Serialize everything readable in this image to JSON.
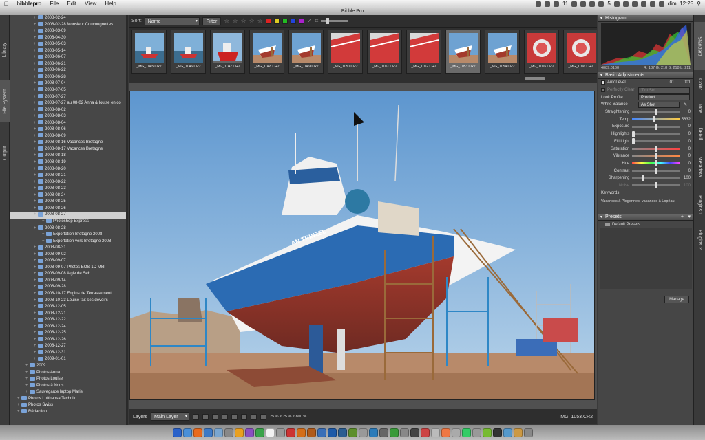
{
  "menubar": {
    "app": "bibblepro",
    "menus": [
      "File",
      "Edit",
      "View",
      "Help"
    ],
    "status_number": "11",
    "battery": "5",
    "clock": "dim. 12:25"
  },
  "window": {
    "title": "Bibble Pro"
  },
  "left_tabs": [
    "Library",
    "File System",
    "Output"
  ],
  "tree": [
    {
      "label": "2008-02-24",
      "depth": 2
    },
    {
      "label": "2008-02-28 Monsieur Coucougnettes",
      "depth": 2
    },
    {
      "label": "2008-03-09",
      "depth": 2
    },
    {
      "label": "2008-04-30",
      "depth": 2
    },
    {
      "label": "2008-05-03",
      "depth": 2
    },
    {
      "label": "2008-05-14",
      "depth": 2
    },
    {
      "label": "2008-06-07",
      "depth": 2
    },
    {
      "label": "2008-06-21",
      "depth": 2
    },
    {
      "label": "2008-06-22",
      "depth": 2
    },
    {
      "label": "2008-06-28",
      "depth": 2
    },
    {
      "label": "2008-07-04",
      "depth": 2
    },
    {
      "label": "2008-07-05",
      "depth": 2
    },
    {
      "label": "2008-07-27",
      "depth": 2
    },
    {
      "label": "2008-07-27 au 08-02 Anna & louise en co",
      "depth": 2
    },
    {
      "label": "2008-08-02",
      "depth": 2
    },
    {
      "label": "2008-08-03",
      "depth": 2
    },
    {
      "label": "2008-08-04",
      "depth": 2
    },
    {
      "label": "2008-08-06",
      "depth": 2
    },
    {
      "label": "2008-08-09",
      "depth": 2
    },
    {
      "label": "2008-08-16 Vacances Bretagne",
      "depth": 2
    },
    {
      "label": "2008-08-17 Vacances Bretagne",
      "depth": 2
    },
    {
      "label": "2008-08-18",
      "depth": 2
    },
    {
      "label": "2008-08-19",
      "depth": 2
    },
    {
      "label": "2008-08-20",
      "depth": 2
    },
    {
      "label": "2008-08-21",
      "depth": 2
    },
    {
      "label": "2008-08-22",
      "depth": 2
    },
    {
      "label": "2008-08-23",
      "depth": 2
    },
    {
      "label": "2008-08-24",
      "depth": 2
    },
    {
      "label": "2008-08-25",
      "depth": 2
    },
    {
      "label": "2008-08-26",
      "depth": 2
    },
    {
      "label": "2008-08-27",
      "depth": 2,
      "selected": true
    },
    {
      "label": "Photoshop Express",
      "depth": 3
    },
    {
      "label": "2008-08-28",
      "depth": 2
    },
    {
      "label": "Exportation Bretagne 2008",
      "depth": 3
    },
    {
      "label": "Exportation vers Bretagne 2008",
      "depth": 3
    },
    {
      "label": "2008-08-31",
      "depth": 2
    },
    {
      "label": "2008-09-02",
      "depth": 2
    },
    {
      "label": "2008-09-07",
      "depth": 2
    },
    {
      "label": "2008-09-07 Photos EOS-1D MkII",
      "depth": 2
    },
    {
      "label": "2008-09-08 Aigle de Seb",
      "depth": 2
    },
    {
      "label": "2008-09-14",
      "depth": 2
    },
    {
      "label": "2008-09-28",
      "depth": 2
    },
    {
      "label": "2008-10-17 Engins de Terrassement",
      "depth": 2
    },
    {
      "label": "2008-10-23 Louise fait ses devoirs",
      "depth": 2
    },
    {
      "label": "2008-12-05",
      "depth": 2
    },
    {
      "label": "2008-12-21",
      "depth": 2
    },
    {
      "label": "2008-12-22",
      "depth": 2
    },
    {
      "label": "2008-12-24",
      "depth": 2
    },
    {
      "label": "2008-12-25",
      "depth": 2
    },
    {
      "label": "2008-12-26",
      "depth": 2
    },
    {
      "label": "2008-12-27",
      "depth": 2
    },
    {
      "label": "2008-12-31",
      "depth": 2
    },
    {
      "label": "2009-01-01",
      "depth": 2
    },
    {
      "label": "2009",
      "depth": 1
    },
    {
      "label": "Photos Anna",
      "depth": 1
    },
    {
      "label": "Photos Louise",
      "depth": 1
    },
    {
      "label": "Photos à Nous",
      "depth": 1
    },
    {
      "label": "Sauvegarde laptop Marie",
      "depth": 1
    },
    {
      "label": "Photos Lufthansa Technik",
      "depth": 0
    },
    {
      "label": "Photos Swiss",
      "depth": 0
    },
    {
      "label": "Rédaction",
      "depth": 0
    }
  ],
  "toolbar": {
    "sort_label": "Sort:",
    "sort_value": "Name",
    "filter_label": "Filter"
  },
  "thumbnails": [
    {
      "name": "_MG_1045.CR2",
      "kind": "harbor"
    },
    {
      "name": "_MG_1046.CR2",
      "kind": "harbor"
    },
    {
      "name": "_MG_1047.CR2",
      "kind": "boat-red"
    },
    {
      "name": "_MG_1048.CR2",
      "kind": "boat-yard"
    },
    {
      "name": "_MG_1049.CR2",
      "kind": "boat-yard"
    },
    {
      "name": "_MG_1050.CR2",
      "kind": "red-hull"
    },
    {
      "name": "_MG_1051.CR2",
      "kind": "red-hull"
    },
    {
      "name": "_MG_1052.CR2",
      "kind": "red-hull"
    },
    {
      "name": "_MG_1053.CR2",
      "kind": "boat-yard",
      "selected": true
    },
    {
      "name": "_MG_1054.CR2",
      "kind": "boat-yard"
    },
    {
      "name": "_MG_1055.CR2",
      "kind": "pipe"
    },
    {
      "name": "_MG_1056.CR2",
      "kind": "pipe"
    }
  ],
  "viewer": {
    "boat_name": "AN TRINZEL"
  },
  "bottombar": {
    "layers_label": "Layers",
    "layer_value": "Main Layer",
    "zoom_text": "25 % < 25 % < 800 %",
    "filename": "_MG_1053.CR2"
  },
  "histogram": {
    "title": "Histogram",
    "coords": "4089,0160",
    "rgb": "R: 187  G: 218  B: 218  L: 211"
  },
  "basic": {
    "title": "Basic Adjustments",
    "autolevel_label": "AutoLevel",
    "autolevel_v1": ".01",
    "autolevel_v2": ".001",
    "perfectly_clear_label": "Perfectly Clear",
    "perfectly_clear_value": "Tint Std",
    "look_profile_label": "Look Profile",
    "look_profile_value": "Product",
    "white_balance_label": "White Balance",
    "white_balance_value": "As Shot",
    "sliders": [
      {
        "label": "Straightening",
        "value": "0",
        "level": 0.5
      },
      {
        "label": "Temp",
        "value": "5632",
        "level": 0.45
      },
      {
        "label": "Exposure",
        "value": "0",
        "level": 0.5
      },
      {
        "label": "Highlights",
        "value": "0",
        "level": 0.0
      },
      {
        "label": "Fill Light",
        "value": "0",
        "level": 0.0
      },
      {
        "label": "Saturation",
        "value": "0",
        "level": 0.5
      },
      {
        "label": "Vibrance",
        "value": "0",
        "level": 0.5
      },
      {
        "label": "Hue",
        "value": "0",
        "level": 0.5
      },
      {
        "label": "Contrast",
        "value": "0",
        "level": 0.5
      },
      {
        "label": "Sharpening",
        "value": "100",
        "level": 0.2
      },
      {
        "label": "Noise",
        "value": "100",
        "level": 0.5
      }
    ],
    "keywords_label": "Keywords",
    "keywords_value": "Vacances à Plogonnec, vacances à Lopéau"
  },
  "presets": {
    "title": "Presets",
    "item": "Default Presets",
    "manage": "Manage"
  },
  "right_tabs": [
    "Standard",
    "Color",
    "Tone",
    "Detail",
    "Metadata",
    "Plugins 1",
    "Plugins 2"
  ],
  "colors": {
    "accent_blue": "#7aa3d8",
    "selection": "#d0d0d0"
  }
}
